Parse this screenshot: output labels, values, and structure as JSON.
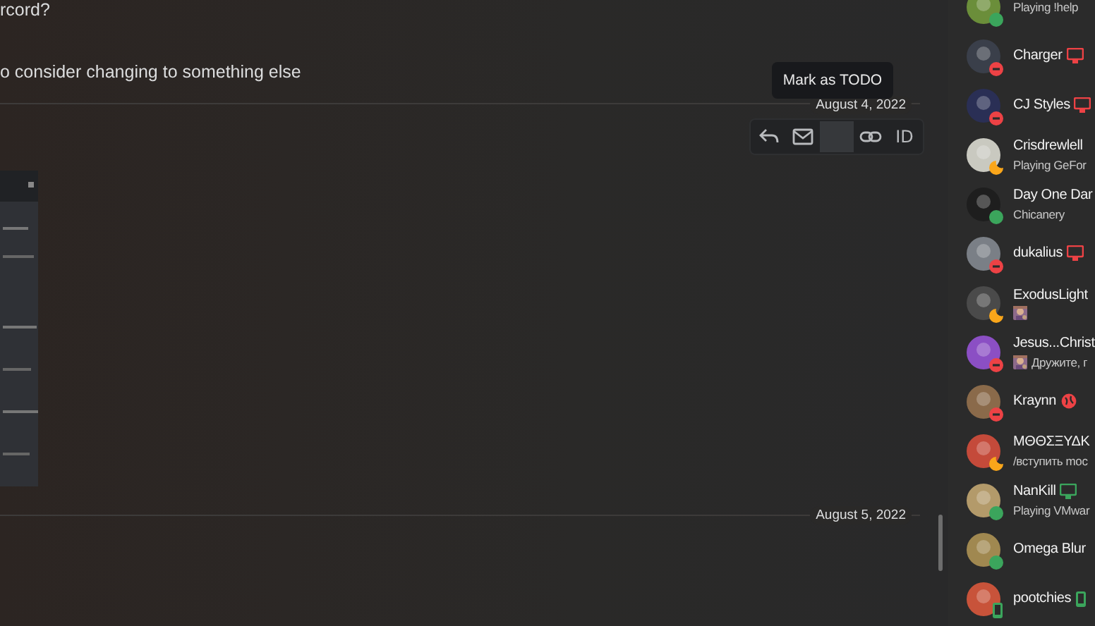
{
  "messages": [
    {
      "text": "rcord?"
    },
    {
      "text": "o consider changing to something else"
    }
  ],
  "date_dividers": [
    {
      "label": "August 4, 2022"
    },
    {
      "label": "August 5, 2022"
    }
  ],
  "tooltip": {
    "text": "Mark as TODO"
  },
  "message_toolbar": [
    {
      "kind": "reply",
      "hovered": false
    },
    {
      "kind": "mail",
      "hovered": false
    },
    {
      "kind": "blank",
      "hovered": true
    },
    {
      "kind": "link",
      "hovered": false
    },
    {
      "kind": "text",
      "label": "ID",
      "hovered": false
    }
  ],
  "members": [
    {
      "status": {
        "kind": "online",
        "color": "#3ba55c"
      },
      "activity": "Playing !help"
    },
    {
      "name": "Charger",
      "status": {
        "kind": "dnd",
        "color": "#ed4245"
      },
      "badge": {
        "kind": "monitor",
        "color": "#ed4245"
      }
    },
    {
      "name": "CJ Styles",
      "status": {
        "kind": "dnd",
        "color": "#ed4245"
      },
      "badge": {
        "kind": "monitor",
        "color": "#ed4245"
      }
    },
    {
      "name": "Crisdrewlell",
      "status": {
        "kind": "idle",
        "color": "#faa61a"
      },
      "activity": "Playing GeFor"
    },
    {
      "name": "Day One Dar",
      "status": {
        "kind": "online",
        "color": "#3ba55c"
      },
      "activity": "Chicanery"
    },
    {
      "name": "dukalius",
      "status": {
        "kind": "dnd",
        "color": "#ed4245"
      },
      "badge": {
        "kind": "monitor",
        "color": "#ed4245"
      }
    },
    {
      "name": "ExodusLight",
      "status": {
        "kind": "idle",
        "color": "#faa61a"
      }
    },
    {
      "name": "Jesus...Christ",
      "status": {
        "kind": "dnd",
        "color": "#ed4245"
      },
      "activity": "Дружите, г"
    },
    {
      "name": "Kraynn",
      "status": {
        "kind": "dnd",
        "color": "#ed4245"
      },
      "badge": {
        "kind": "globe",
        "color": "#ed4245"
      }
    },
    {
      "name": "MΘΘΣΞΥΔΚ",
      "status": {
        "kind": "idle",
        "color": "#faa61a"
      },
      "activity": "/вступить moc"
    },
    {
      "name": "NanKill",
      "status": {
        "kind": "online",
        "color": "#3ba55c"
      },
      "badge": {
        "kind": "monitor",
        "color": "#3ba55c"
      },
      "activity": "Playing VMwar"
    },
    {
      "name": "Omega Blur",
      "status": {
        "kind": "online",
        "color": "#3ba55c"
      }
    },
    {
      "name": "pootchies",
      "status": {
        "kind": "mobile",
        "color": "#3ba55c"
      },
      "badge": {
        "kind": "phone",
        "color": "#3ba55c"
      }
    }
  ]
}
